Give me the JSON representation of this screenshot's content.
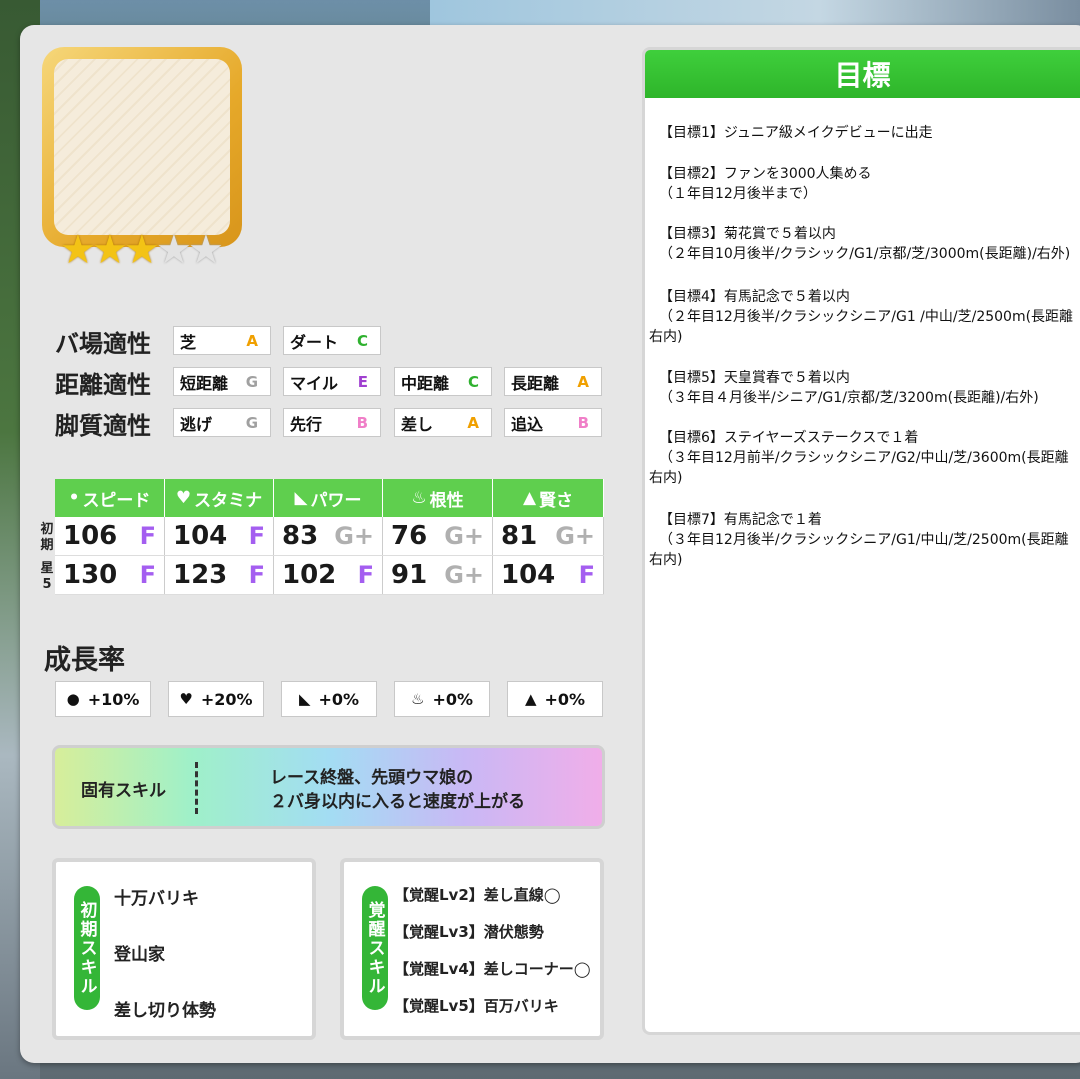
{
  "rarity": {
    "stars_on": 3,
    "stars_total": 5
  },
  "aptitude": {
    "track": {
      "label": "バ場適性",
      "items": [
        {
          "name": "芝",
          "grade": "A",
          "color": "#f0a000"
        },
        {
          "name": "ダート",
          "grade": "C",
          "color": "#2fb12f"
        }
      ]
    },
    "distance": {
      "label": "距離適性",
      "items": [
        {
          "name": "短距離",
          "grade": "G",
          "color": "#a0a0a0"
        },
        {
          "name": "マイル",
          "grade": "E",
          "color": "#a040d0"
        },
        {
          "name": "中距離",
          "grade": "C",
          "color": "#2fb12f"
        },
        {
          "name": "長距離",
          "grade": "A",
          "color": "#f0a000"
        }
      ]
    },
    "style": {
      "label": "脚質適性",
      "items": [
        {
          "name": "逃げ",
          "grade": "G",
          "color": "#a0a0a0"
        },
        {
          "name": "先行",
          "grade": "B",
          "color": "#f07fc8"
        },
        {
          "name": "差し",
          "grade": "A",
          "color": "#f0a000"
        },
        {
          "name": "追込",
          "grade": "B",
          "color": "#f07fc8"
        }
      ]
    }
  },
  "stats": {
    "headers": [
      "スピード",
      "スタミナ",
      "パワー",
      "根性",
      "賢さ"
    ],
    "header_icons": [
      "foot-icon",
      "heart-icon",
      "arm-icon",
      "flame-icon",
      "mortarboard-icon"
    ],
    "row_labels": [
      "初期",
      "星5"
    ],
    "rows": [
      [
        {
          "v": "106",
          "g": "F"
        },
        {
          "v": "104",
          "g": "F"
        },
        {
          "v": "83",
          "g": "G+"
        },
        {
          "v": "76",
          "g": "G+"
        },
        {
          "v": "81",
          "g": "G+"
        }
      ],
      [
        {
          "v": "130",
          "g": "F"
        },
        {
          "v": "123",
          "g": "F"
        },
        {
          "v": "102",
          "g": "F"
        },
        {
          "v": "91",
          "g": "G+"
        },
        {
          "v": "104",
          "g": "F"
        }
      ]
    ],
    "grade_colors": {
      "F": "#a45ef0",
      "G+": "#b0b0b0"
    }
  },
  "growth": {
    "title": "成長率",
    "items": [
      "+10%",
      "+20%",
      "+0%",
      "+0%",
      "+0%"
    ]
  },
  "unique_skill": {
    "label": "固有スキル",
    "desc_line1": "レース終盤、先頭ウマ娘の",
    "desc_line2": "２バ身以内に入ると速度が上がる"
  },
  "initial_skills": {
    "tag": "初期スキル",
    "items": [
      "十万バリキ",
      "登山家",
      "差し切り体勢"
    ]
  },
  "awakening_skills": {
    "tag": "覚醒スキル",
    "items": [
      "【覚醒Lv2】差し直線◯",
      "【覚醒Lv3】潜伏態勢",
      "【覚醒Lv4】差しコーナー◯",
      "【覚醒Lv5】百万バリキ"
    ]
  },
  "goals": {
    "title": "目標",
    "items": [
      {
        "l1": "【目標1】ジュニア級メイクデビューに出走",
        "l2": "",
        "l3": ""
      },
      {
        "l1": "【目標2】ファンを3000人集める",
        "l2": "（１年目12月後半まで）",
        "l3": ""
      },
      {
        "l1": "【目標3】菊花賞で５着以内",
        "l2": "（２年目10月後半/クラシック/G1/京都/芝/3000m(長距離)/右外)",
        "l3": ""
      },
      {
        "l1": "【目標4】有馬記念で５着以内",
        "l2": "（２年目12月後半/クラシックシニア/G1 /中山/芝/2500m(長距離",
        "l3": "右内)"
      },
      {
        "l1": "【目標5】天皇賞春で５着以内",
        "l2": "（３年目４月後半/シニア/G1/京都/芝/3200m(長距離)/右外)",
        "l3": ""
      },
      {
        "l1": "【目標6】ステイヤーズステークスで１着",
        "l2": "（３年目12月前半/クラシックシニア/G2/中山/芝/3600m(長距離",
        "l3": "右内)"
      },
      {
        "l1": "【目標7】有馬記念で１着",
        "l2": "（３年目12月後半/クラシックシニア/G1/中山/芝/2500m(長距離",
        "l3": "右内)"
      }
    ]
  }
}
